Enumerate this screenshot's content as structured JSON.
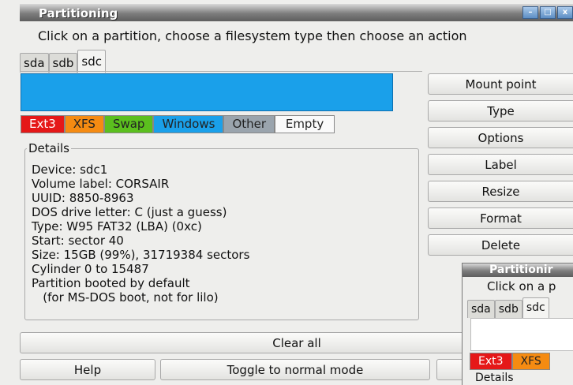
{
  "window": {
    "title": "Partitioning"
  },
  "instruction": "Click on a partition, choose a filesystem type then choose an action",
  "tabs": [
    "sda",
    "sdb",
    "sdc"
  ],
  "active_tab": "sdc",
  "legend": [
    "Ext3",
    "XFS",
    "Swap",
    "Windows",
    "Other",
    "Empty"
  ],
  "details": {
    "title": "Details",
    "lines": [
      "Device: sdc1",
      "Volume label: CORSAIR",
      "UUID: 8850-8963",
      "DOS drive letter: C (just a guess)",
      "Type: W95 FAT32 (LBA) (0xc)",
      "Start: sector 40",
      "Size: 15GB (99%), 31719384 sectors",
      "Cylinder 0 to 15487",
      "Partition booted by default",
      "   (for MS-DOS boot, not for lilo)"
    ]
  },
  "actions": [
    "Mount point",
    "Type",
    "Options",
    "Label",
    "Resize",
    "Format",
    "Delete"
  ],
  "bottom": {
    "clear_all": "Clear all",
    "help": "Help",
    "toggle": "Toggle to normal mode"
  },
  "overlay_window": {
    "title": "Partitionir",
    "instruction": "Click on a p",
    "tabs": [
      "sda",
      "sdb",
      "sdc"
    ],
    "legend": [
      "Ext3",
      "XFS"
    ],
    "details_title": "Details"
  },
  "colors": {
    "ext3": "#e51818",
    "xfs": "#f58b12",
    "swap": "#5bbf1e",
    "windows": "#1aa0ea",
    "other": "#9aa4ad",
    "empty": "#fafafa"
  }
}
